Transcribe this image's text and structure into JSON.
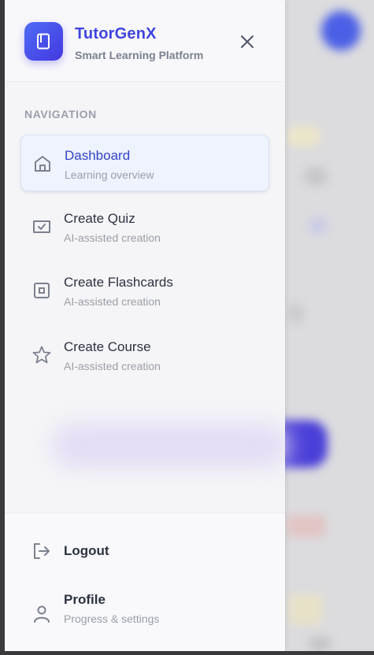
{
  "header": {
    "app_title": "TutorGenX",
    "app_subtitle": "Smart Learning Platform",
    "logo_icon": "book-icon",
    "close_icon": "close-icon"
  },
  "navigation": {
    "section_label": "NAVIGATION",
    "items": [
      {
        "title": "Dashboard",
        "subtitle": "Learning overview",
        "icon": "home-icon",
        "active": true
      },
      {
        "title": "Create Quiz",
        "subtitle": "AI-assisted creation",
        "icon": "quiz-check-icon",
        "active": false
      },
      {
        "title": "Create Flashcards",
        "subtitle": "AI-assisted creation",
        "icon": "flashcard-icon",
        "active": false
      },
      {
        "title": "Create Course",
        "subtitle": "AI-assisted creation",
        "icon": "star-icon",
        "active": false
      }
    ]
  },
  "bottom": {
    "logout": {
      "title": "Logout",
      "icon": "logout-icon"
    },
    "profile": {
      "title": "Profile",
      "subtitle": "Progress & settings",
      "icon": "user-icon"
    }
  },
  "colors": {
    "brand": "#3f45dd",
    "logo_gradient_start": "#4f6cf5",
    "logo_gradient_end": "#4338e0",
    "active_bg": "#eef3fd",
    "muted_text": "#9a9ea8"
  }
}
